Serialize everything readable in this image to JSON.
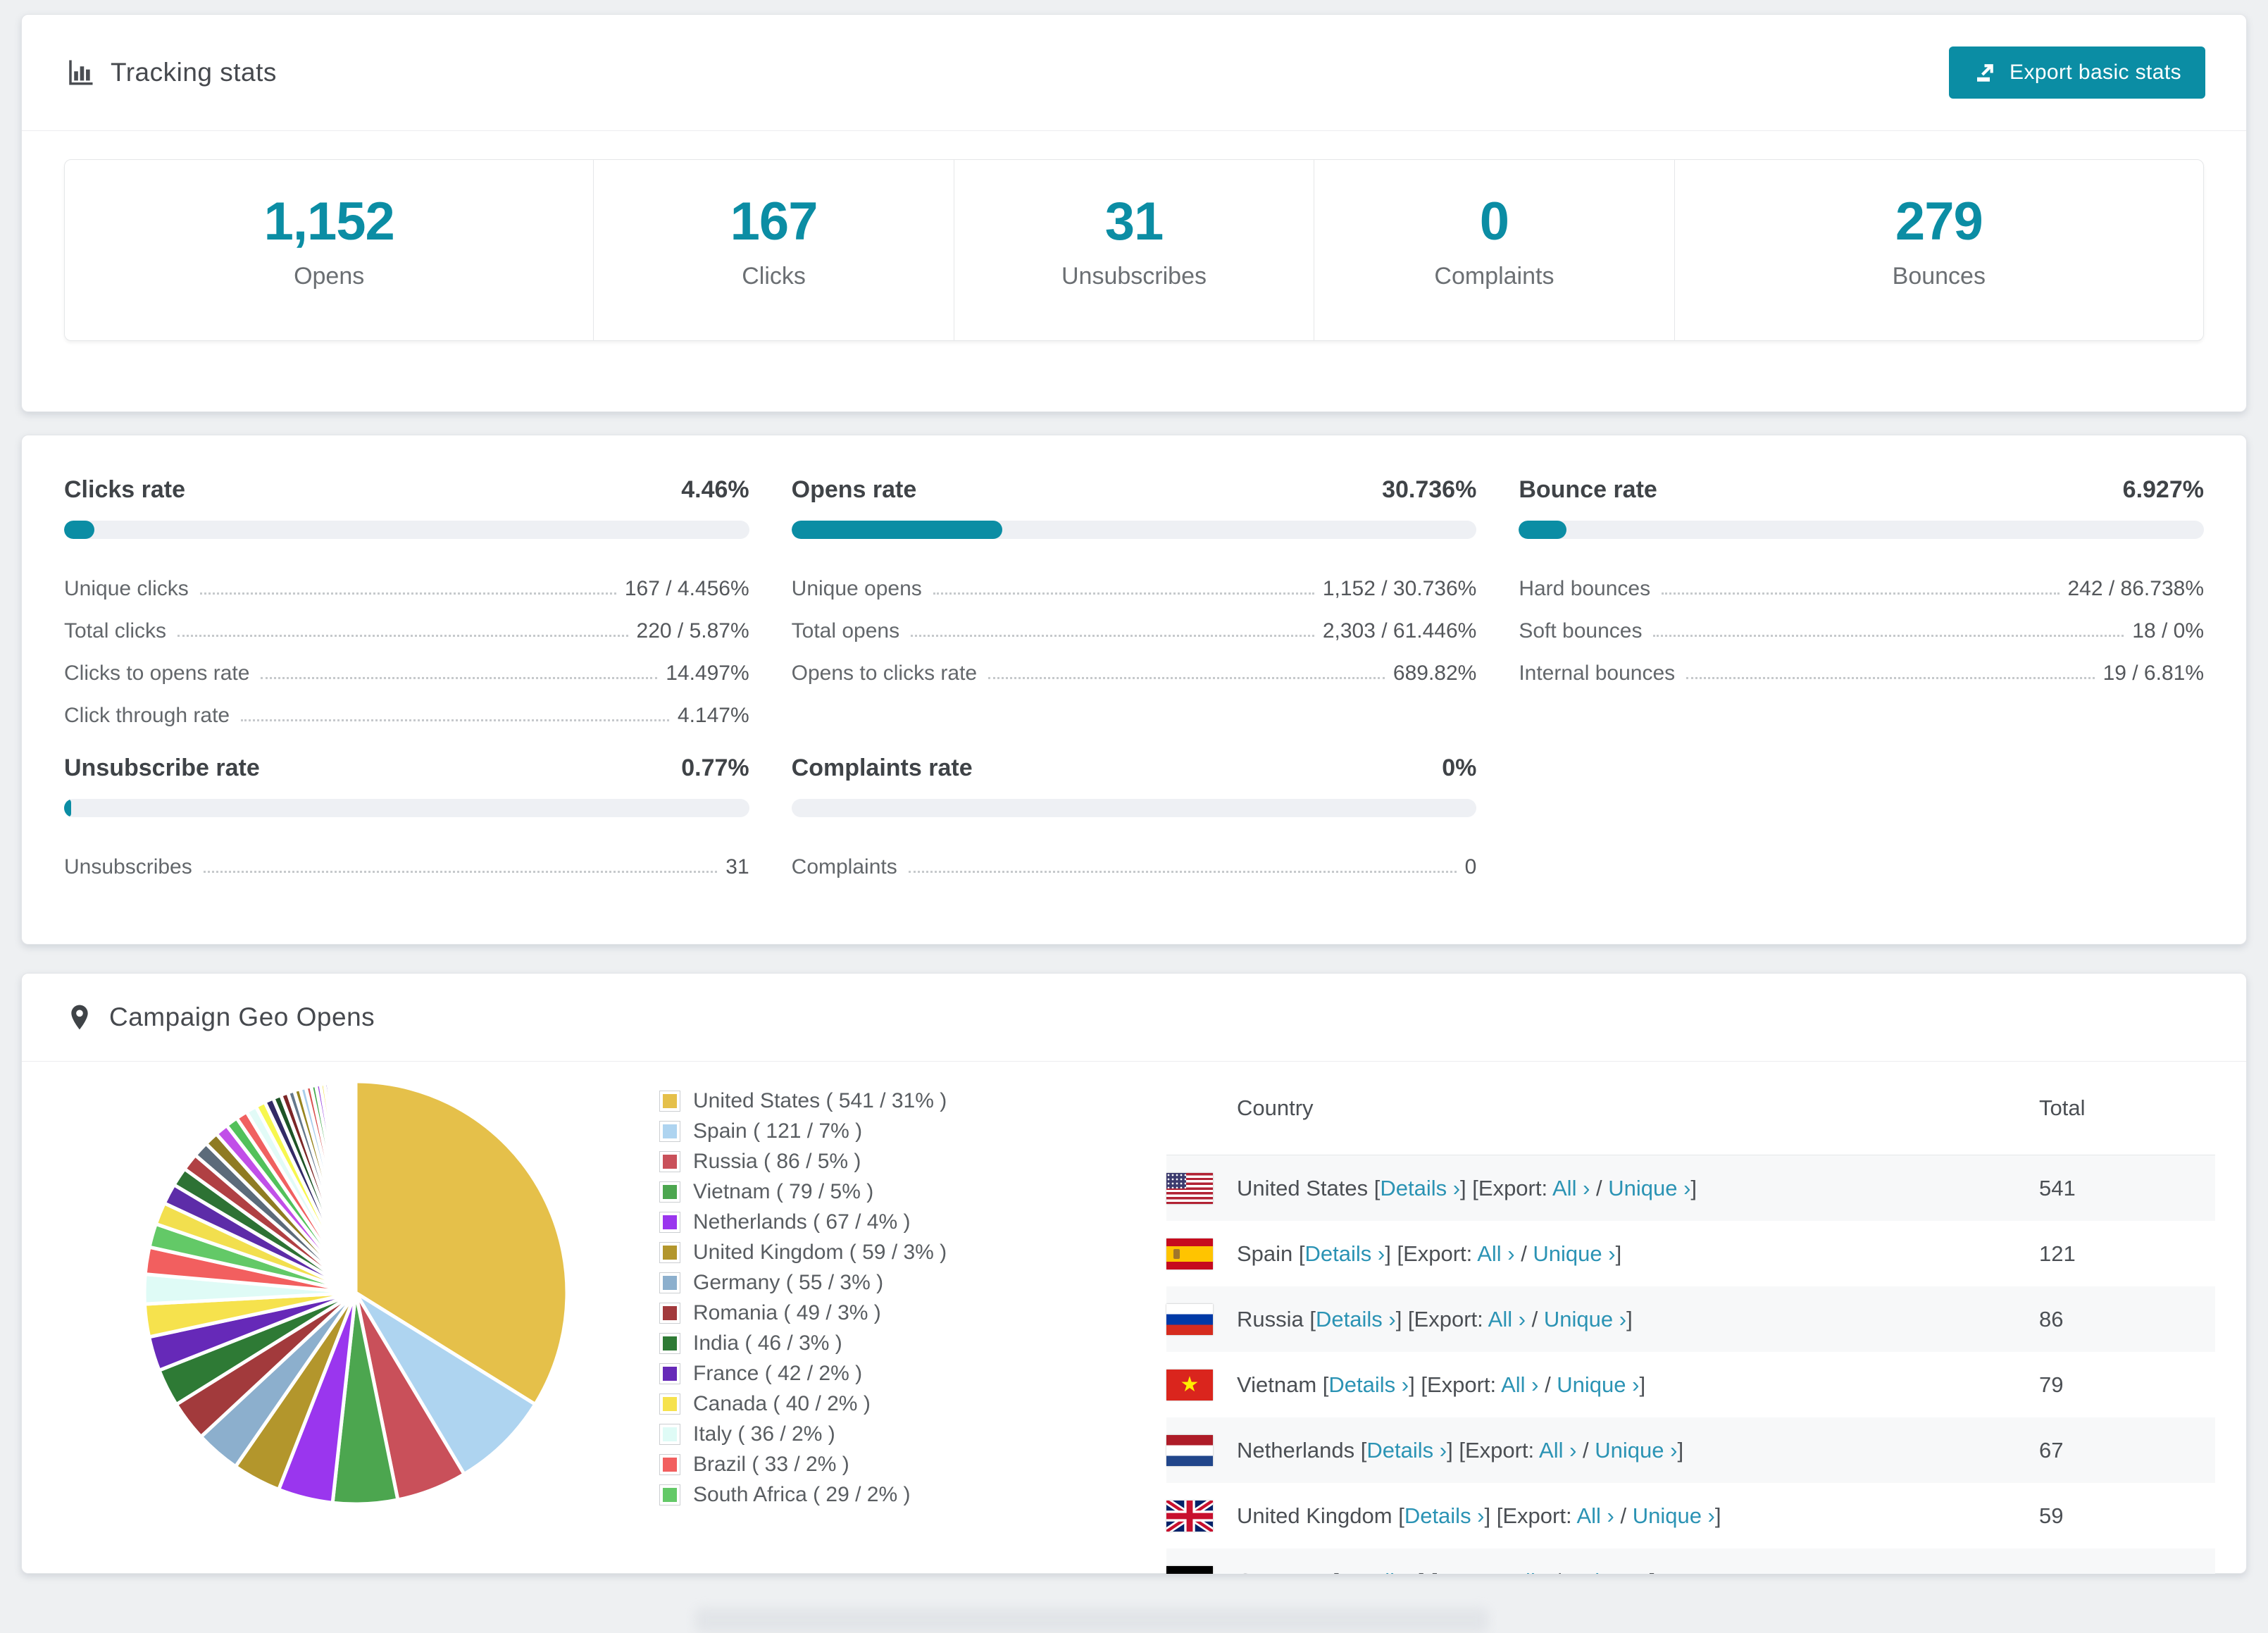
{
  "accent_color": "#0b8da4",
  "link_color": "#2b93b4",
  "header": {
    "title": "Tracking stats",
    "export_label": "Export basic stats"
  },
  "summary": [
    {
      "value": "1,152",
      "label": "Opens"
    },
    {
      "value": "167",
      "label": "Clicks"
    },
    {
      "value": "31",
      "label": "Unsubscribes"
    },
    {
      "value": "0",
      "label": "Complaints"
    },
    {
      "value": "279",
      "label": "Bounces"
    }
  ],
  "rates": [
    {
      "title": "Clicks rate",
      "percent": "4.46%",
      "fill": 4.46,
      "rows": [
        {
          "label": "Unique clicks",
          "value": "167 / 4.456%"
        },
        {
          "label": "Total clicks",
          "value": "220 / 5.87%"
        },
        {
          "label": "Clicks to opens rate",
          "value": "14.497%"
        },
        {
          "label": "Click through rate",
          "value": "4.147%"
        }
      ]
    },
    {
      "title": "Opens rate",
      "percent": "30.736%",
      "fill": 30.736,
      "rows": [
        {
          "label": "Unique opens",
          "value": "1,152 / 30.736%"
        },
        {
          "label": "Total opens",
          "value": "2,303 / 61.446%"
        },
        {
          "label": "Opens to clicks rate",
          "value": "689.82%"
        }
      ]
    },
    {
      "title": "Bounce rate",
      "percent": "6.927%",
      "fill": 6.927,
      "rows": [
        {
          "label": "Hard bounces",
          "value": "242 / 86.738%"
        },
        {
          "label": "Soft bounces",
          "value": "18 / 0%"
        },
        {
          "label": "Internal bounces",
          "value": "19 / 6.81%"
        }
      ]
    },
    {
      "title": "Unsubscribe rate",
      "percent": "0.77%",
      "fill": 0.77,
      "rows": [
        {
          "label": "Unsubscribes",
          "value": "31"
        }
      ]
    },
    {
      "title": "Complaints rate",
      "percent": "0%",
      "fill": 0,
      "rows": [
        {
          "label": "Complaints",
          "value": "0"
        }
      ]
    }
  ],
  "geo": {
    "title": "Campaign Geo Opens"
  },
  "chart_data": {
    "type": "pie",
    "title": "Campaign Geo Opens",
    "unit": "opens",
    "legend_position": "right of pie",
    "slices": [
      {
        "label": "United States",
        "value": 541,
        "pct": "31%",
        "color": "#e5c04a",
        "legend_label": "United States ( 541 / 31% )"
      },
      {
        "label": "Spain",
        "value": 121,
        "pct": "7%",
        "color": "#aed4f0",
        "legend_label": "Spain ( 121 / 7% )"
      },
      {
        "label": "Russia",
        "value": 86,
        "pct": "5%",
        "color": "#c9505a",
        "legend_label": "Russia ( 86 / 5% )"
      },
      {
        "label": "Vietnam",
        "value": 79,
        "pct": "5%",
        "color": "#4ca64f",
        "legend_label": "Vietnam ( 79 / 5% )"
      },
      {
        "label": "Netherlands",
        "value": 67,
        "pct": "4%",
        "color": "#9a36ee",
        "legend_label": "Netherlands ( 67 / 4% )"
      },
      {
        "label": "United Kingdom",
        "value": 59,
        "pct": "3%",
        "color": "#b3962c",
        "legend_label": "United Kingdom ( 59 / 3% )"
      },
      {
        "label": "Germany",
        "value": 55,
        "pct": "3%",
        "color": "#8cafcd",
        "legend_label": "Germany ( 55 / 3% )"
      },
      {
        "label": "Romania",
        "value": 49,
        "pct": "3%",
        "color": "#a23a3c",
        "legend_label": "Romania ( 49 / 3% )"
      },
      {
        "label": "India",
        "value": 46,
        "pct": "3%",
        "color": "#2e7a35",
        "legend_label": "India ( 46 / 3% )"
      },
      {
        "label": "France",
        "value": 42,
        "pct": "2%",
        "color": "#6629b8",
        "legend_label": "France ( 42 / 2% )"
      },
      {
        "label": "Canada",
        "value": 40,
        "pct": "2%",
        "color": "#f6e24d",
        "legend_label": "Canada ( 40 / 2% )"
      },
      {
        "label": "Italy",
        "value": 36,
        "pct": "2%",
        "color": "#dffbf6",
        "legend_label": "Italy ( 36 / 2% )"
      },
      {
        "label": "Brazil",
        "value": 33,
        "pct": "2%",
        "color": "#f25f5f",
        "legend_label": "Brazil ( 33 / 2% )"
      },
      {
        "label": "South Africa",
        "value": 29,
        "pct": "2%",
        "color": "#63c967",
        "legend_label": "South Africa ( 29 / 2% )"
      }
    ],
    "unlabeled_small_slices": {
      "note": "remaining countries below 2%, drawn as shrinking slivers toward 12 o'clock",
      "values": [
        27,
        25,
        23,
        21,
        19,
        17,
        16,
        15,
        14,
        13,
        12,
        11,
        10,
        9,
        8,
        7.5,
        7,
        6.5,
        6,
        5.5,
        5,
        4.5,
        4,
        3.6,
        3.2,
        2.9,
        2.6,
        2.3,
        2,
        1.8,
        1.6,
        1.4,
        1.2,
        1,
        0.9,
        0.8,
        0.7,
        0.6,
        0.5,
        0.45,
        0.4,
        0.35,
        0.3,
        0.25,
        0.2,
        0.15
      ],
      "palette": [
        "#f2df4e",
        "#5d2ca8",
        "#2d7234",
        "#b04043",
        "#5c6b7a",
        "#8f7b22",
        "#c14fe8",
        "#52c15b",
        "#f06060",
        "#e2fbf7",
        "#f7f74f",
        "#332a66",
        "#1e5426",
        "#7c2626",
        "#64788c",
        "#97841f",
        "#a9cdeb",
        "#d8514f",
        "#42a94c",
        "#9a46e0"
      ]
    }
  },
  "geo_table": {
    "headers": [
      "Country",
      "Total"
    ],
    "link_labels": {
      "details": "Details ›",
      "all": "All ›",
      "unique": "Unique ›"
    },
    "syntax": {
      "open": " [",
      "mid": "] [",
      "export_prefix": "Export: ",
      "slash": " / ",
      "close": "]"
    },
    "rows": [
      {
        "country": "United States",
        "flag": "us",
        "total": "541"
      },
      {
        "country": "Spain",
        "flag": "es",
        "total": "121"
      },
      {
        "country": "Russia",
        "flag": "ru",
        "total": "86"
      },
      {
        "country": "Vietnam",
        "flag": "vn",
        "total": "79"
      },
      {
        "country": "Netherlands",
        "flag": "nl",
        "total": "67"
      },
      {
        "country": "United Kingdom",
        "flag": "gb",
        "total": "59"
      },
      {
        "country": "Germany",
        "flag": "de",
        "total": ""
      }
    ]
  }
}
